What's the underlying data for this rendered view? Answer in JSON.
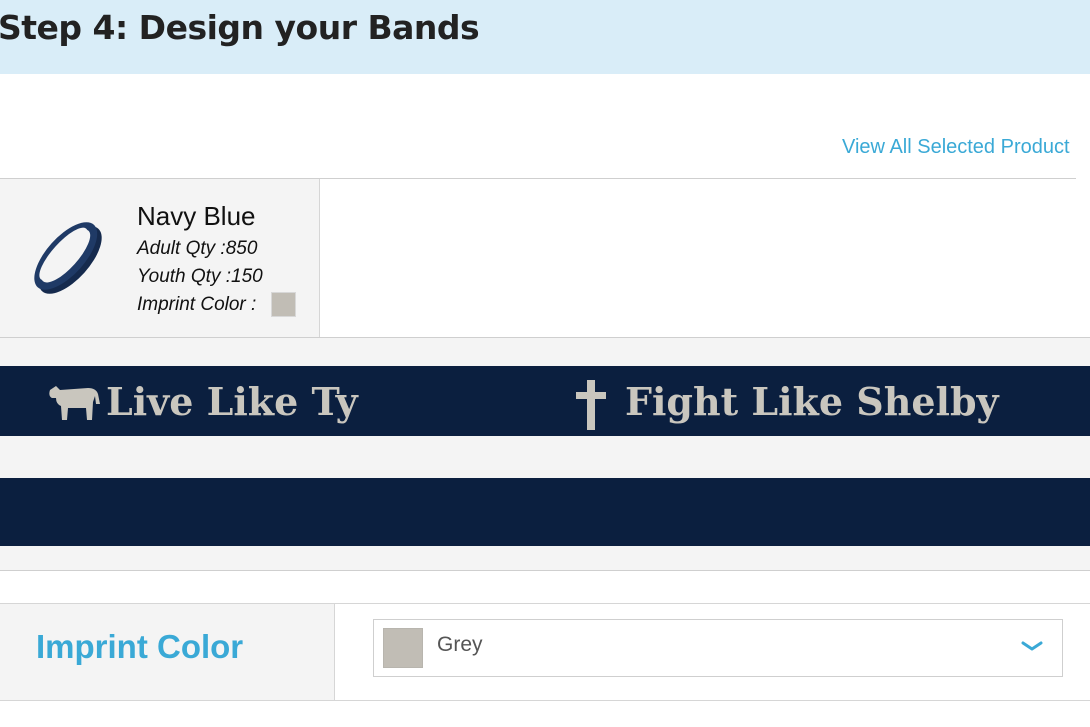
{
  "header": {
    "title": "Step 4: Design your Bands",
    "bg_color": "#d9edf8"
  },
  "links": {
    "view_all": "View All Selected Product"
  },
  "product": {
    "name": "Navy Blue",
    "adult_qty": "Adult Qty :850",
    "youth_qty": "Youth Qty :150",
    "imprint_color_label": "Imprint Color :",
    "band_color": "#0b1f3f",
    "imprint_swatch_color": "#c1bdb5"
  },
  "preview": {
    "front_left_text": "Live Like Ty",
    "front_right_text": "Fight Like Shelby",
    "icons": [
      "cow-icon",
      "cross-icon"
    ]
  },
  "options": {
    "imprint_color": {
      "label": "Imprint Color",
      "selected": "Grey",
      "swatch_color": "#c1bdb5"
    }
  },
  "accent_color": "#3aa9d6"
}
